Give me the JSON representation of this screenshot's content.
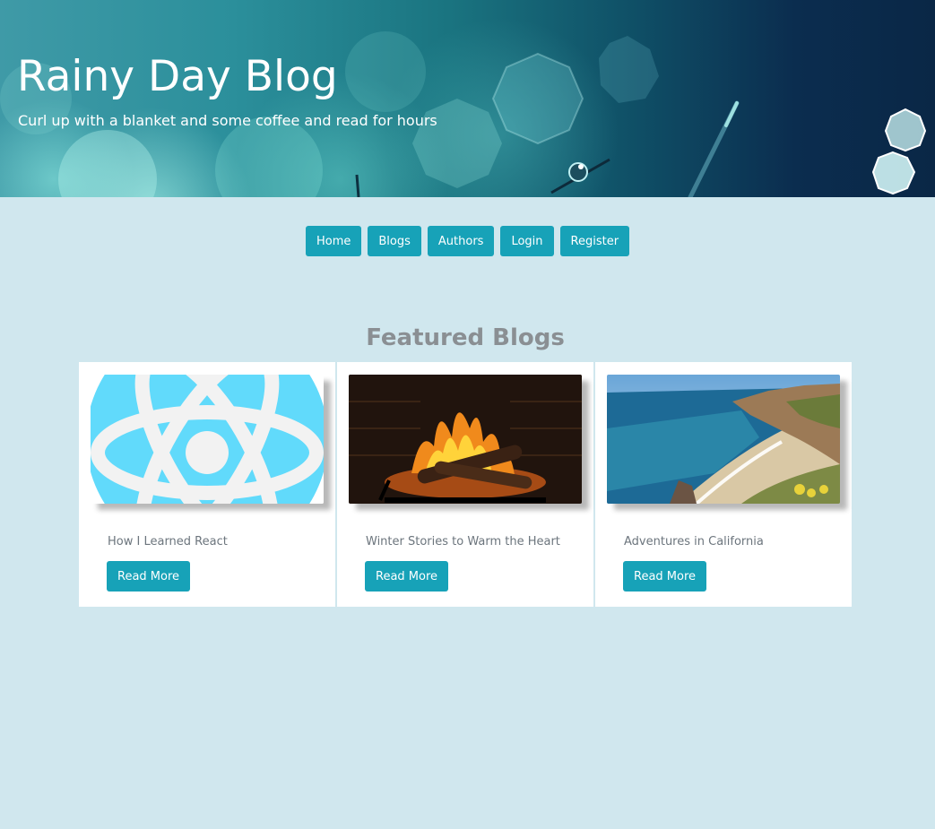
{
  "header": {
    "title": "Rainy Day Blog",
    "subtitle": "Curl up with a blanket and some coffee and read for hours"
  },
  "nav": {
    "items": [
      {
        "label": "Home"
      },
      {
        "label": "Blogs"
      },
      {
        "label": "Authors"
      },
      {
        "label": "Login"
      },
      {
        "label": "Register"
      }
    ]
  },
  "featured": {
    "heading": "Featured Blogs",
    "cards": [
      {
        "title": "How I Learned React",
        "button": "Read More",
        "image": "react-logo-icon"
      },
      {
        "title": "Winter Stories to Warm the Heart",
        "button": "Read More",
        "image": "fireplace-image"
      },
      {
        "title": "Adventures in California",
        "button": "Read More",
        "image": "coastline-image"
      }
    ]
  },
  "colors": {
    "page_bg": "#d0e7ee",
    "accent": "#17a2b8",
    "heading_gray": "#8a8f93",
    "card_text": "#6c757d"
  }
}
